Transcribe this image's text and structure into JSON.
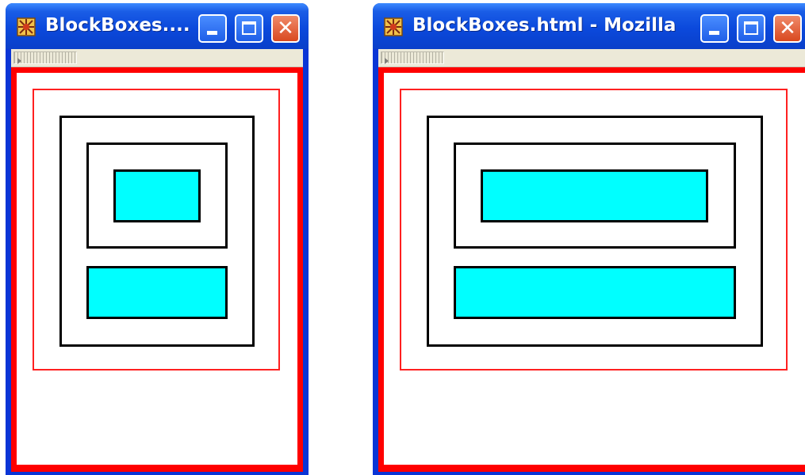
{
  "windows": [
    {
      "title": "BlockBoxes....",
      "buttons": {
        "minimize": "",
        "maximize": "",
        "close": "✕"
      },
      "icon": "mozilla-app-icon",
      "colors": {
        "titlebar": "#0b49dc",
        "border_red": "#ff0000",
        "fill_cyan": "#00ffff"
      }
    },
    {
      "title": "BlockBoxes.html - Mozilla",
      "buttons": {
        "minimize": "",
        "maximize": "",
        "close": "✕"
      },
      "icon": "mozilla-app-icon",
      "colors": {
        "titlebar": "#0b49dc",
        "border_red": "#ff0000",
        "fill_cyan": "#00ffff"
      }
    }
  ]
}
